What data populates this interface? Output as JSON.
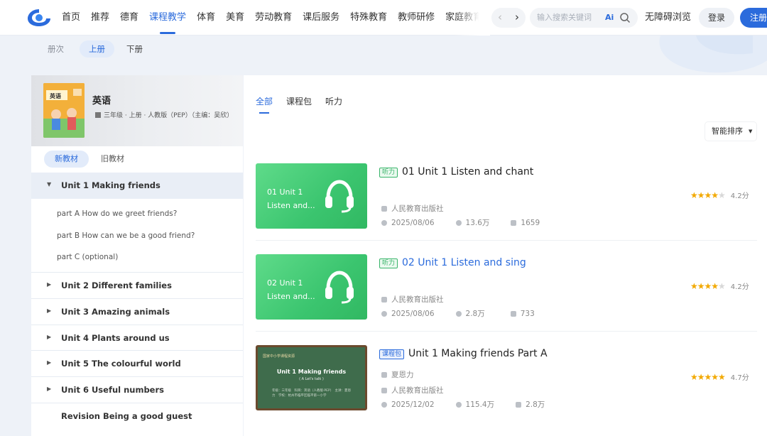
{
  "header": {
    "nav": [
      "首页",
      "推荐",
      "德育",
      "课程教学",
      "体育",
      "美育",
      "劳动教育",
      "课后服务",
      "特殊教育",
      "教师研修",
      "家庭教育",
      "教"
    ],
    "active_nav": 3,
    "search_placeholder": "输入搜索关键词",
    "ai_label": "Ai",
    "accessibility": "无障碍浏览",
    "login": "登录",
    "register": "注册",
    "accent": "#2b6bdc"
  },
  "volume": {
    "label": "册次",
    "tabs": [
      "上册",
      "下册"
    ],
    "active": 0
  },
  "book": {
    "title": "英语",
    "meta": "三年级 · 上册 · 人教版（PEP）（主编：吴欣）",
    "cover_text": "英语"
  },
  "edition_tabs": [
    "新教材",
    "旧教材"
  ],
  "units": [
    {
      "label": "Unit 1 Making friends",
      "open": true,
      "parts": [
        "part A How do we greet friends?",
        "part B How can we be a good friend?",
        "part C (optional)"
      ]
    },
    {
      "label": "Unit 2 Different families"
    },
    {
      "label": "Unit 3 Amazing animals"
    },
    {
      "label": "Unit 4 Plants around us"
    },
    {
      "label": "Unit 5 The colourful world"
    },
    {
      "label": "Unit 6 Useful numbers"
    },
    {
      "label": "Revision Being a good guest"
    }
  ],
  "content_tabs": [
    "全部",
    "课程包",
    "听力"
  ],
  "sort": "智能排序",
  "items": [
    {
      "thumb_text": "01 Unit 1\nListen and...",
      "badge": "听力",
      "title": "01 Unit 1 Listen and chant",
      "publisher": "人民教育出版社",
      "date": "2025/08/06",
      "views": "13.6万",
      "likes": "1659",
      "rating": 4.2,
      "rating_text": "4.2分"
    },
    {
      "thumb_text": "02 Unit 1\nListen and...",
      "badge": "听力",
      "title": "02 Unit 1 Listen and sing",
      "publisher": "人民教育出版社",
      "date": "2025/08/06",
      "views": "2.8万",
      "likes": "733",
      "rating": 4.2,
      "rating_text": "4.2分"
    },
    {
      "thumb_header": "国家中小学课程资源",
      "thumb_title": "Unit 1 Making friends",
      "thumb_sub": "( A Let's talk )",
      "thumb_info": "年级：三年级　科目：英语（人教版·PEP）　主讲：夏恩力　学校：杭州市临平区临平第一小学",
      "badge": "课程包",
      "title": "Unit 1 Making friends Part A",
      "author": "夏恩力",
      "publisher": "人民教育出版社",
      "date": "2025/12/02",
      "views": "115.4万",
      "likes": "2.8万",
      "rating": 4.7,
      "rating_text": "4.7分"
    }
  ]
}
